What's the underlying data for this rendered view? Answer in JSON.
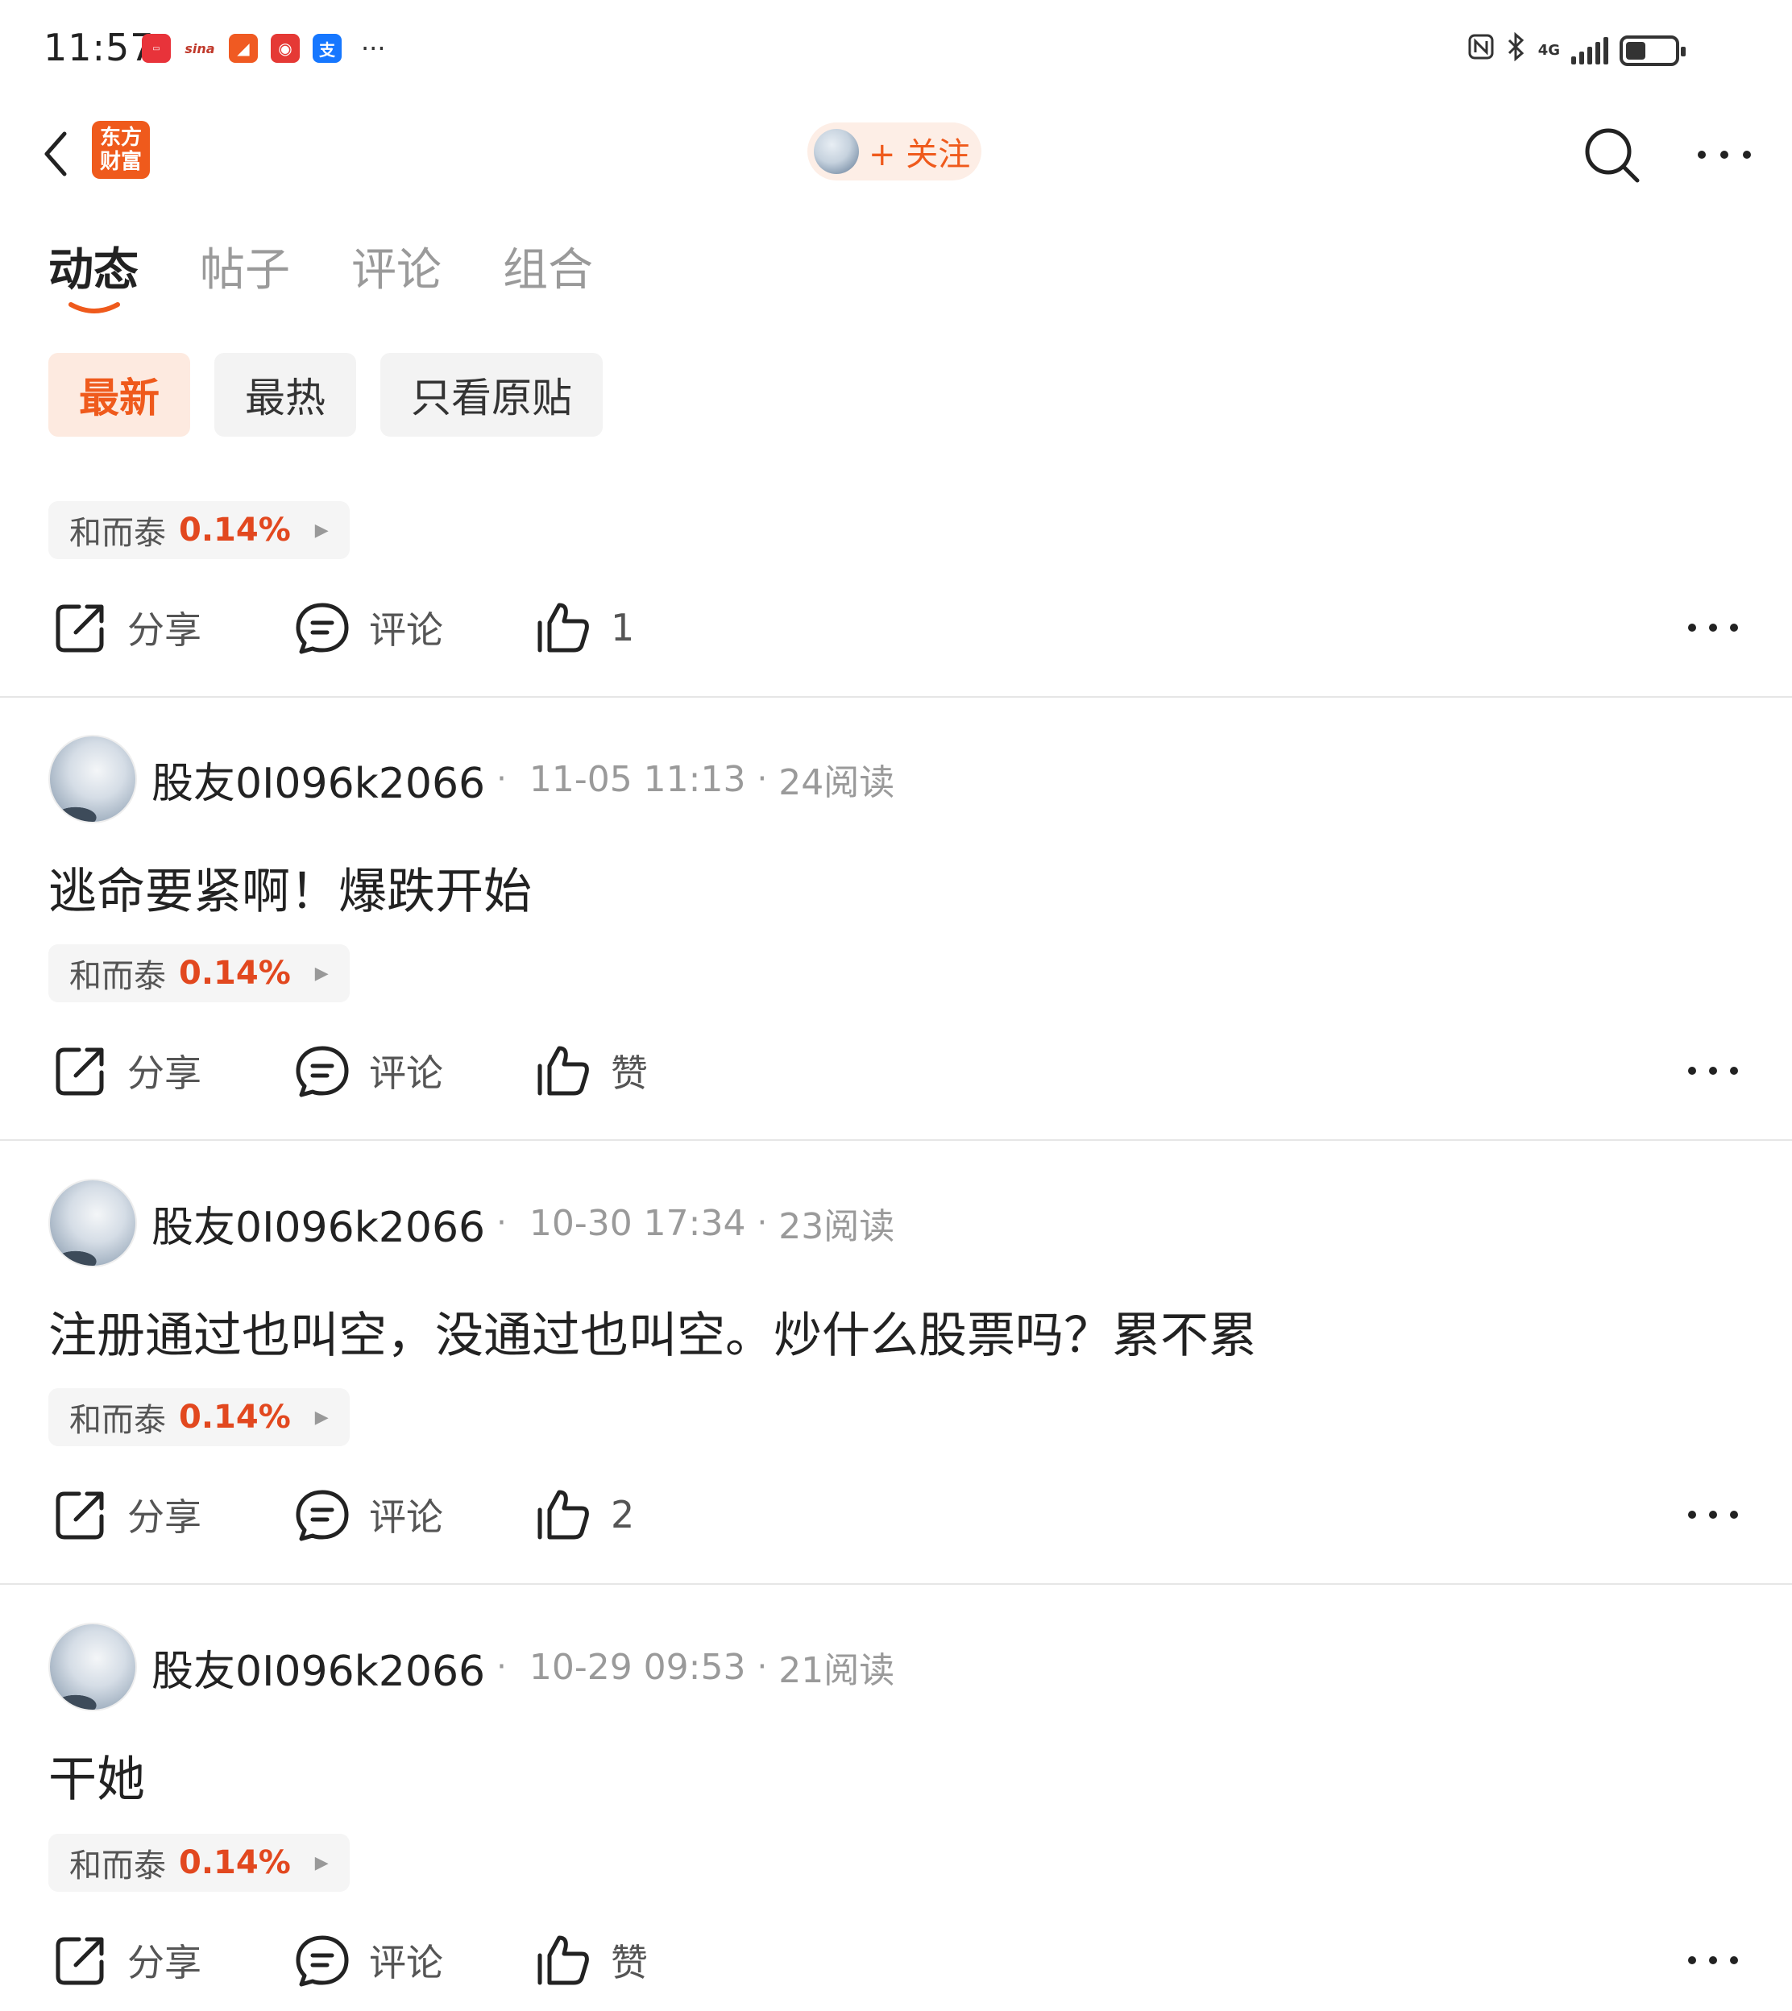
{
  "status_bar": {
    "time": "11:57",
    "apps": [
      {
        "icon": "huawei-store-icon",
        "glyph": "▭",
        "color": "#e8333a"
      },
      {
        "icon": "sina-icon",
        "glyph": "sina",
        "color": "#ffffff"
      },
      {
        "icon": "telegram-like-icon",
        "glyph": "◢",
        "color": "#f05a22"
      },
      {
        "icon": "news-app-icon",
        "glyph": "◉",
        "color": "#e53935"
      },
      {
        "icon": "alipay-icon",
        "glyph": "支",
        "color": "#1677ff"
      }
    ],
    "more": "···",
    "network": "4G"
  },
  "nav": {
    "brand_line1": "东方",
    "brand_line2": "财富",
    "follow_label": "+ 关注"
  },
  "tabs": [
    {
      "label": "动态",
      "active": true
    },
    {
      "label": "帖子",
      "active": false
    },
    {
      "label": "评论",
      "active": false
    },
    {
      "label": "组合",
      "active": false
    }
  ],
  "filters": [
    {
      "label": "最新",
      "active": true
    },
    {
      "label": "最热",
      "active": false
    },
    {
      "label": "只看原贴",
      "active": false
    }
  ],
  "posts": [
    {
      "stock": {
        "name": "和而泰",
        "change": "0.14%"
      },
      "actions": {
        "share": "分享",
        "comment": "评论",
        "like": "1"
      }
    },
    {
      "author": "股友0I096k2066",
      "time": "11-05 11:13",
      "reads": "24阅读",
      "body": "逃命要紧啊！爆跌开始",
      "stock": {
        "name": "和而泰",
        "change": "0.14%"
      },
      "actions": {
        "share": "分享",
        "comment": "评论",
        "like": "赞"
      }
    },
    {
      "author": "股友0I096k2066",
      "time": "10-30 17:34",
      "reads": "23阅读",
      "body": "注册通过也叫空，没通过也叫空。炒什么股票吗？累不累",
      "stock": {
        "name": "和而泰",
        "change": "0.14%"
      },
      "actions": {
        "share": "分享",
        "comment": "评论",
        "like": "2"
      }
    },
    {
      "author": "股友0I096k2066",
      "time": "10-29 09:53",
      "reads": "21阅读",
      "body": "干她",
      "stock": {
        "name": "和而泰",
        "change": "0.14%"
      },
      "actions": {
        "share": "分享",
        "comment": "评论",
        "like": "赞"
      }
    }
  ],
  "colors": {
    "accent": "#ef5a1c",
    "stock_up": "#e2481f"
  }
}
